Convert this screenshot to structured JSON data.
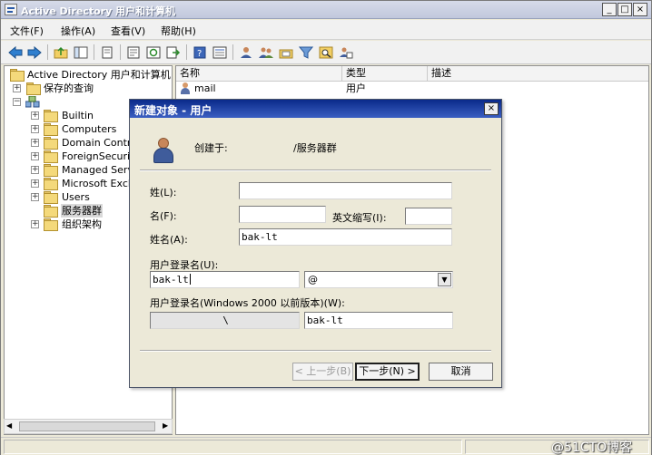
{
  "window": {
    "title": "Active Directory 用户和计算机",
    "min_glyph": "_",
    "max_glyph": "□",
    "close_glyph": "×"
  },
  "menu": [
    "文件(F)",
    "操作(A)",
    "查看(V)",
    "帮助(H)"
  ],
  "toolbar": {
    "icons": [
      "back-icon",
      "forward-icon",
      "up-folder-icon",
      "show-tree-icon",
      "copy-icon",
      "properties-icon",
      "refresh-icon",
      "export-icon",
      "help-icon",
      "details-icon",
      "new-user-icon",
      "new-group-icon",
      "new-ou-icon",
      "filter-icon",
      "find-icon",
      "add-to-group-icon"
    ]
  },
  "tree": {
    "root": "Active Directory 用户和计算机",
    "saved_queries": "保存的查询",
    "domain_label": "",
    "children": [
      "Builtin",
      "Computers",
      "Domain Control",
      "ForeignSecurit",
      "Managed Servic",
      "Microsoft Exch",
      "Users",
      "服务器群",
      "组织架构"
    ],
    "selected": "服务器群"
  },
  "list": {
    "columns": [
      "名称",
      "类型",
      "描述"
    ],
    "rows": [
      {
        "name": "mail",
        "type": "用户",
        "description": ""
      }
    ]
  },
  "dialog": {
    "title": "新建对象 - 用户",
    "created_in_label": "创建于:",
    "created_in_value": "/服务器群",
    "last_name_label": "姓(L):",
    "last_name_value": "",
    "first_name_label": "名(F):",
    "first_name_value": "",
    "initials_label": "英文缩写(I):",
    "initials_value": "",
    "full_name_label": "姓名(A):",
    "full_name_value": "bak-lt",
    "logon_name_label": "用户登录名(U):",
    "logon_name_value": "bak-lt",
    "domain_suffix": "@",
    "pre2000_label": "用户登录名(Windows 2000 以前版本)(W):",
    "pre2000_domain": "\\",
    "pre2000_value": "bak-lt",
    "back_button": "< 上一步(B)",
    "next_button": "下一步(N) >",
    "cancel_button": "取消"
  },
  "watermark": "@51CTO博客"
}
